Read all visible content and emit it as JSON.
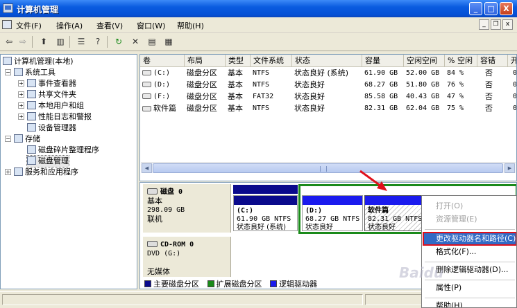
{
  "window": {
    "title": "计算机管理",
    "min": "_",
    "max": "□",
    "close": "X"
  },
  "menubar": {
    "items": [
      "文件(F)",
      "操作(A)",
      "查看(V)",
      "窗口(W)",
      "帮助(H)"
    ],
    "sub_min": "_",
    "sub_restore": "❐",
    "sub_close": "x"
  },
  "toolbar": {
    "icons": [
      "back-arrow",
      "forward-arrow",
      "up-folder",
      "show-hide-tree",
      "properties",
      "help",
      "console-tree",
      "refresh",
      "delete",
      "properties-2",
      "export"
    ]
  },
  "tree": {
    "root": "计算机管理(本地)",
    "system_tools": "系统工具",
    "event_viewer": "事件查看器",
    "shared_folders": "共享文件夹",
    "local_users": "本地用户和组",
    "perf_logs": "性能日志和警报",
    "device_manager": "设备管理器",
    "storage": "存储",
    "defrag": "磁盘碎片整理程序",
    "disk_mgmt": "磁盘管理",
    "services": "服务和应用程序"
  },
  "volumes": {
    "columns": [
      "卷",
      "布局",
      "类型",
      "文件系统",
      "状态",
      "容量",
      "空闲空间",
      "% 空闲",
      "容错",
      "开"
    ],
    "rows": [
      [
        "(C:)",
        "磁盘分区",
        "基本",
        "NTFS",
        "状态良好 (系统)",
        "61.90 GB",
        "52.00 GB",
        "84 %",
        "否",
        "0"
      ],
      [
        "(D:)",
        "磁盘分区",
        "基本",
        "NTFS",
        "状态良好",
        "68.27 GB",
        "51.80 GB",
        "76 %",
        "否",
        "0"
      ],
      [
        "(F:)",
        "磁盘分区",
        "基本",
        "FAT32",
        "状态良好",
        "85.58 GB",
        "40.43 GB",
        "47 %",
        "否",
        "0"
      ],
      [
        "软件篇",
        "磁盘分区",
        "基本",
        "NTFS",
        "状态良好",
        "82.31 GB",
        "62.04 GB",
        "75 %",
        "否",
        "0"
      ]
    ]
  },
  "disk0": {
    "name": "磁盘 0",
    "type": "基本",
    "size": "298.09 GB",
    "status": "联机",
    "partitions": [
      {
        "label": "(C:)",
        "detail": "61.90 GB NTFS",
        "status": "状态良好 (系统)"
      },
      {
        "label": "(D:)",
        "detail": "68.27 GB NTFS",
        "status": "状态良好"
      },
      {
        "label": "软件篇",
        "detail": "82.31 GB NTFS",
        "status": "状态良好"
      }
    ]
  },
  "cdrom0": {
    "name": "CD-ROM 0",
    "type": "DVD (G:)",
    "media": "无媒体"
  },
  "legend": [
    "主要磁盘分区",
    "扩展磁盘分区",
    "逻辑驱动器"
  ],
  "colors": {
    "primary": "#0a0a8c",
    "extended": "#1a8a1a",
    "logical": "#1a1aee",
    "highlight": "#316ac5",
    "annotation": "#e0101a"
  },
  "context_menu": {
    "open": "打开(O)",
    "explore": "资源管理(E)",
    "change_letter": "更改驱动器名和路径(C)...",
    "format": "格式化(F)...",
    "delete_logical": "删除逻辑驱动器(D)...",
    "properties": "属性(P)",
    "help": "帮助(H)"
  },
  "watermark": "Baidu"
}
